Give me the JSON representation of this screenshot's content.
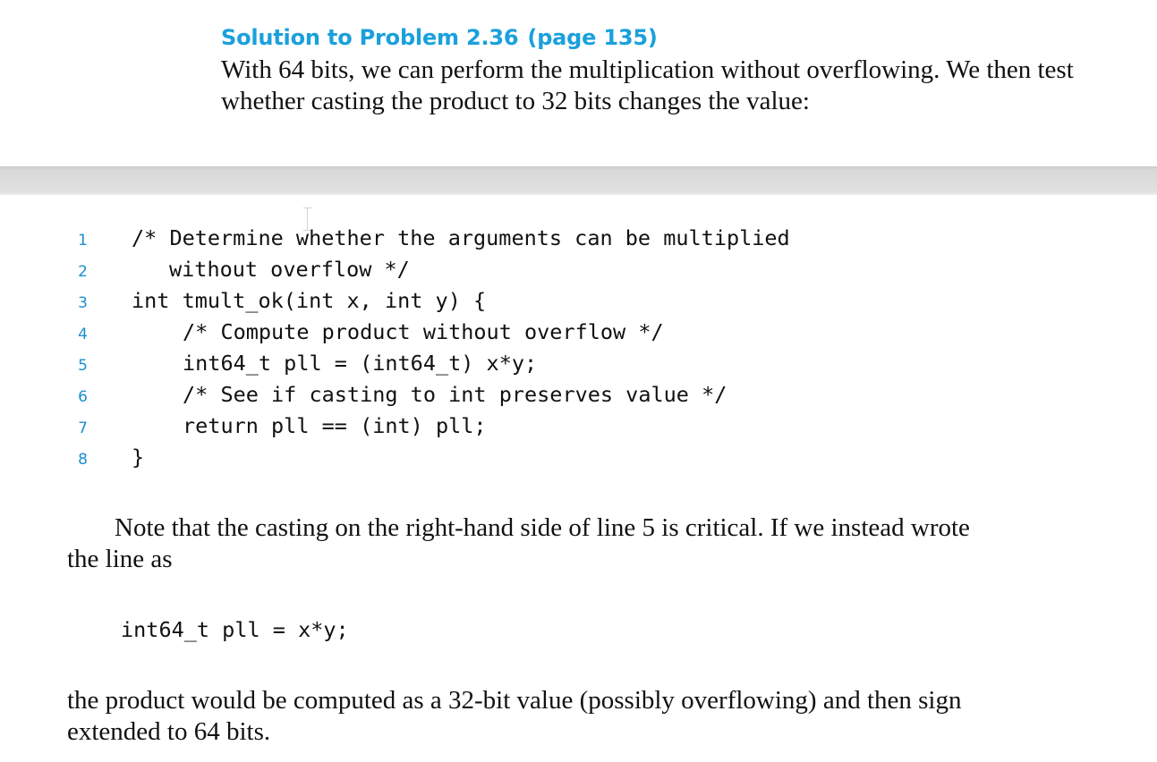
{
  "solution": {
    "heading": "Solution to Problem 2.36",
    "page_ref": "(page 135)",
    "intro": "With 64 bits, we can perform the multiplication without overflowing. We then test whether casting the product to 32 bits changes the value:"
  },
  "code": {
    "lines": [
      {
        "number": "1",
        "text": "/* Determine whether the arguments can be multiplied"
      },
      {
        "number": "2",
        "text": "without overflow */"
      },
      {
        "number": "3",
        "text": "int tmult_ok(int x, int y) {"
      },
      {
        "number": "4",
        "text": "/* Compute product without overflow */"
      },
      {
        "number": "5",
        "text": "int64_t pll = (int64_t) x*y;"
      },
      {
        "number": "6",
        "text": "/* See if casting to int preserves value */"
      },
      {
        "number": "7",
        "text": "return pll == (int) pll;"
      },
      {
        "number": "8",
        "text": "}"
      }
    ]
  },
  "note": "Note that the casting on the right-hand side of line 5 is critical. If we instead wrote the line as",
  "inline_code": "int64_t pll = x*y;",
  "conclusion": "the product would be computed as a 32-bit value (possibly overflowing) and then sign extended to 64 bits.",
  "colors": {
    "heading": "#1aa0dc",
    "line_numbers": "#1a8fd0",
    "divider": "#d9d9d9",
    "text": "#111111"
  }
}
